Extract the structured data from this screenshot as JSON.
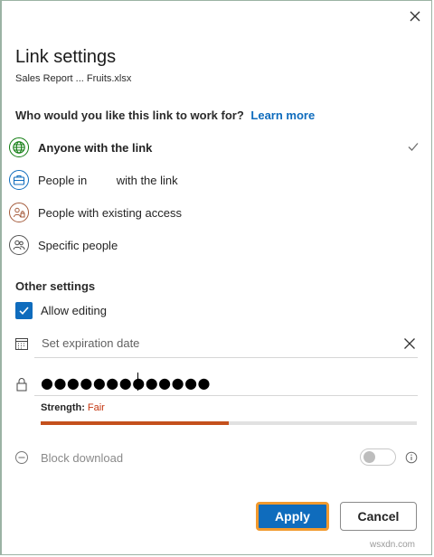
{
  "dialog": {
    "title": "Link settings",
    "filename": "Sales Report ... Fruits.xlsx",
    "close_icon": "close-icon"
  },
  "audience": {
    "question": "Who would you like this link to work for?",
    "learn_more": "Learn more",
    "options": [
      {
        "label": "Anyone with the link",
        "icon": "globe-icon",
        "selected": true
      },
      {
        "label": "People in         with the link",
        "icon": "briefcase-icon",
        "selected": false
      },
      {
        "label": "People with existing access",
        "icon": "people-lock-icon",
        "selected": false
      },
      {
        "label": "Specific people",
        "icon": "people-icon",
        "selected": false
      }
    ]
  },
  "other_settings": {
    "heading": "Other settings",
    "allow_editing": {
      "label": "Allow editing",
      "checked": true
    },
    "expiration": {
      "placeholder": "Set expiration date",
      "icon": "calendar-icon"
    },
    "password": {
      "value": "●●●●●●●●●●●●●",
      "icon": "lock-icon"
    },
    "strength": {
      "label": "Strength:",
      "value": "Fair",
      "level": 0.5
    },
    "block_download": {
      "label": "Block download",
      "enabled": false
    }
  },
  "buttons": {
    "apply": "Apply",
    "cancel": "Cancel"
  },
  "watermark": "wsxdn.com",
  "colors": {
    "accent": "#0f6cbd",
    "apply_outline": "#f29a2e",
    "strength_fair": "#c4350f",
    "meter_fill": "#c4501c"
  }
}
